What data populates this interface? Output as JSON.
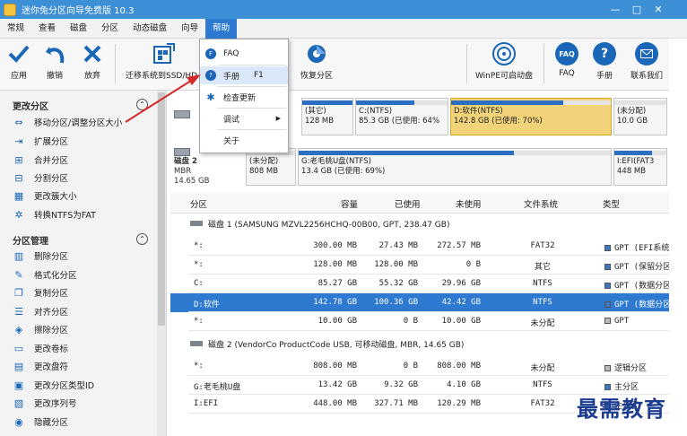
{
  "window": {
    "title": "迷你兔分区向导免费版 10.3",
    "controls": [
      "—",
      "□",
      "✕"
    ]
  },
  "menu": [
    "常规",
    "查看",
    "磁盘",
    "分区",
    "动态磁盘",
    "向导",
    "帮助"
  ],
  "toolbar": {
    "apply": "应用",
    "undo": "撤销",
    "discard": "放弃",
    "migrate": "迁移系统到SSD/HD",
    "recover": "恢复分区",
    "winpe": "WinPE可启动盘",
    "faq": "FAQ",
    "manual": "手册",
    "contact": "联系我们"
  },
  "help_menu": {
    "faq": "FAQ",
    "manual": "手册",
    "manual_shortcut": "F1",
    "check_update": "检查更新",
    "debug": "调试",
    "about": "关于",
    "faq_icon_text": "FAQ",
    "manual_icon_text": "?"
  },
  "sidebar": {
    "section1": "更改分区",
    "section1_items": [
      "移动分区/调整分区大小",
      "扩展分区",
      "合并分区",
      "分割分区",
      "更改簇大小",
      "转换NTFS为FAT"
    ],
    "section2": "分区管理",
    "section2_items": [
      "删除分区",
      "格式化分区",
      "复制分区",
      "对齐分区",
      "擦除分区",
      "更改卷标",
      "更改盘符",
      "更改分区类型ID",
      "更改序列号",
      "隐藏分区"
    ]
  },
  "diskmap": {
    "disk1_partial": [
      "(其它)",
      "128 MB"
    ],
    "disk1_c": [
      "C:(NTFS)",
      "85.3 GB (已使用: 64%"
    ],
    "disk1_d": [
      "D:软件(NTFS)",
      "142.8 GB (已使用: 70%)"
    ],
    "disk1_u": [
      "(未分配)",
      "10.0 GB"
    ],
    "disk2": [
      "磁盘 2",
      "MBR",
      "14.65 GB"
    ],
    "disk2_u": [
      "(未分配)",
      "808 MB"
    ],
    "disk2_g": [
      "G:老毛桃U盘(NTFS)",
      "13.4 GB (已使用: 69%)"
    ],
    "disk2_efi": [
      "I:EFI(FAT3",
      "448 MB"
    ]
  },
  "table": {
    "headers": [
      "分区",
      "容量",
      "已使用",
      "未使用",
      "文件系统",
      "类型"
    ],
    "disk1": "磁盘 1 (SAMSUNG MZVL2256HCHQ-00B00, GPT, 238.47 GB)",
    "disk1_rows": [
      [
        "*:",
        "300.00 MB",
        "27.43 MB",
        "272.57 MB",
        "FAT32",
        "GPT (EFI系统"
      ],
      [
        "*:",
        "128.00 MB",
        "128.00 MB",
        "0 B",
        "其它",
        "GPT (保留分区"
      ],
      [
        "C:",
        "85.27 GB",
        "55.32 GB",
        "29.96 GB",
        "NTFS",
        "GPT (数据分区"
      ],
      [
        "D:软件",
        "142.78 GB",
        "100.36 GB",
        "42.42 GB",
        "NTFS",
        "GPT (数据分区"
      ],
      [
        "*:",
        "10.00 GB",
        "0 B",
        "10.00 GB",
        "未分配",
        "GPT"
      ]
    ],
    "disk2": "磁盘 2 (VendorCo ProductCode USB, 可移动磁盘, MBR, 14.65 GB)",
    "disk2_rows": [
      [
        "*:",
        "808.00 MB",
        "0 B",
        "808.00 MB",
        "未分配",
        "逻辑分区"
      ],
      [
        "G:老毛桃U盘",
        "13.42 GB",
        "9.32 GB",
        "4.10 GB",
        "NTFS",
        "主分区"
      ],
      [
        "I:EFI",
        "448.00 MB",
        "327.71 MB",
        "120.29 MB",
        "FAT32",
        "主分区"
      ]
    ]
  },
  "usage": {
    "disk1_c": 0.64,
    "disk1_d": 0.7,
    "disk2_g": 0.69,
    "disk2_efi": 0.73,
    "disk1_partial": 1.0
  },
  "watermark": "最需教育",
  "colors": {
    "accent": "#2d7ad0",
    "title_bar": "#3d8fd6",
    "selected_block": "#f1d37a",
    "annotation": "#d62a2a"
  }
}
